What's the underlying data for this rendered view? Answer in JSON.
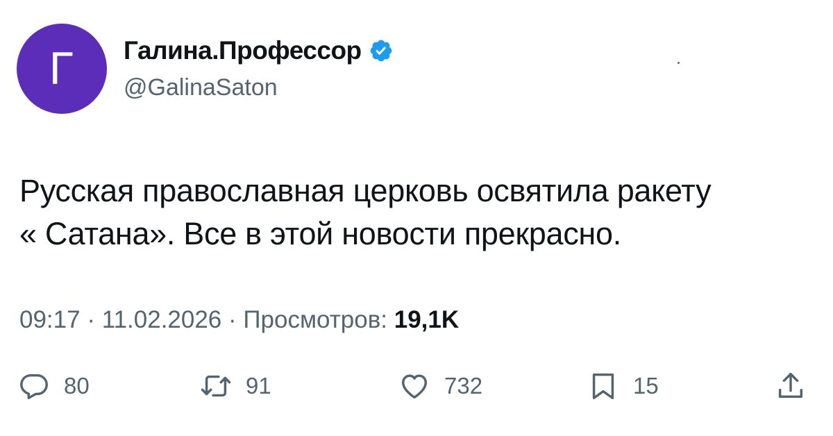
{
  "author": {
    "avatar_letter": "Г",
    "avatar_color": "#5c2db8",
    "display_name": "Галина.Профессор",
    "handle": "@GalinaSaton",
    "verified_icon": "verified-badge-icon",
    "verified_color": "#1d9bf0"
  },
  "tweet": {
    "lines": [
      "Русская православная церковь освятила ракету",
      "« Сатана». Все в этой новости прекрасно."
    ]
  },
  "meta": {
    "time": "09:17",
    "separator": " · ",
    "date": "11.02.2026",
    "views_label": "Просмотров:",
    "views_count": "19,1K"
  },
  "actions": {
    "replies": {
      "icon": "reply-icon",
      "count": "80"
    },
    "retweets": {
      "icon": "retweet-icon",
      "count": "91"
    },
    "likes": {
      "icon": "heart-icon",
      "count": "732"
    },
    "bookmarks": {
      "icon": "bookmark-icon",
      "count": "15"
    },
    "share": {
      "icon": "share-icon"
    }
  }
}
